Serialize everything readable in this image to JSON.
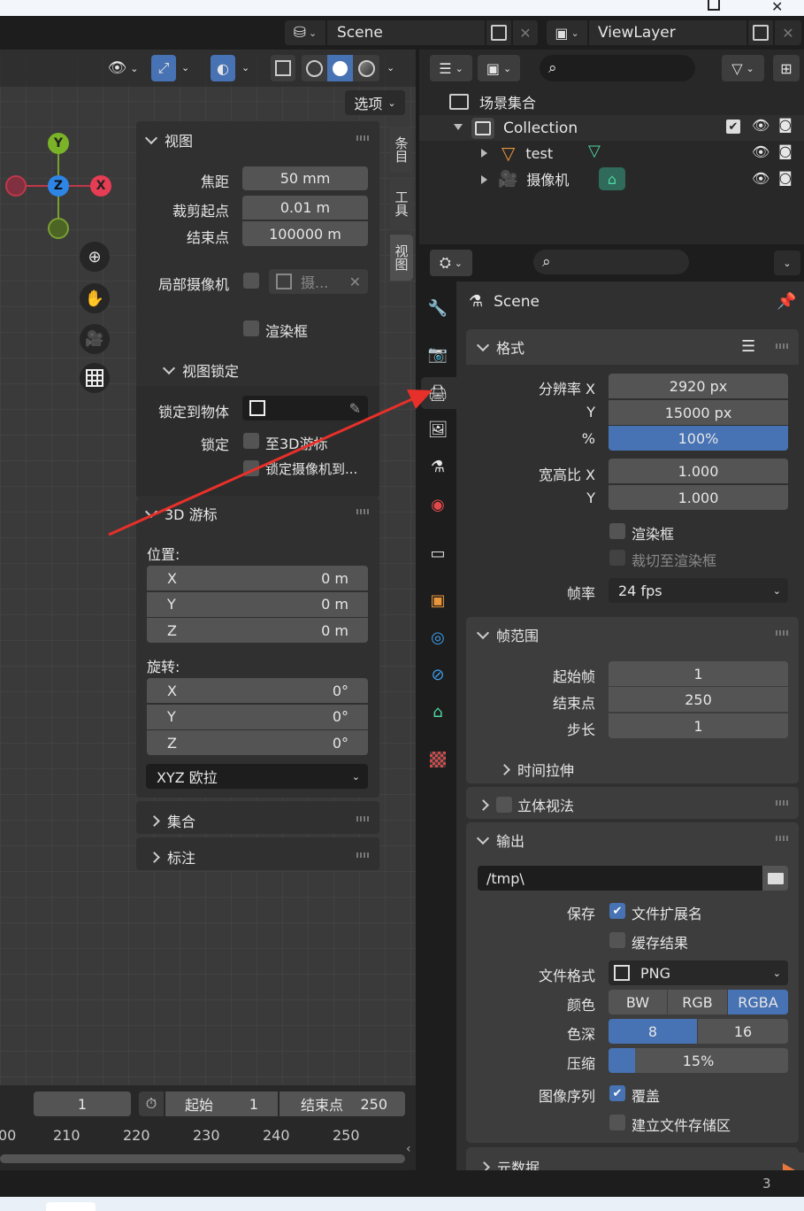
{
  "header": {
    "scene": "Scene",
    "view_layer": "ViewLayer"
  },
  "viewport": {
    "options_label": "选项",
    "gizmo": {
      "y": "Y",
      "z": "Z",
      "x": "X"
    },
    "tabs": [
      "条目",
      "工具",
      "视图"
    ]
  },
  "n_panel": {
    "view_title": "视图",
    "focal_label": "焦距",
    "focal_value": "50 mm",
    "clip_start_label": "裁剪起点",
    "clip_start_value": "0.01 m",
    "clip_end_label": "结束点",
    "clip_end_value": "100000 m",
    "local_camera_label": "局部摄像机",
    "local_camera_value": "摄...",
    "render_border_label": "渲染框",
    "view_lock_title": "视图锁定",
    "lock_object_label": "锁定到物体",
    "lock_label": "锁定",
    "lock_cursor_label": "至3D游标",
    "lock_camera_label": "锁定摄像机到...",
    "cursor_title": "3D 游标",
    "location_label": "位置:",
    "loc": [
      {
        "axis": "X",
        "value": "0 m"
      },
      {
        "axis": "Y",
        "value": "0 m"
      },
      {
        "axis": "Z",
        "value": "0 m"
      }
    ],
    "rotation_label": "旋转:",
    "rot": [
      {
        "axis": "X",
        "value": "0°"
      },
      {
        "axis": "Y",
        "value": "0°"
      },
      {
        "axis": "Z",
        "value": "0°"
      }
    ],
    "rot_mode": "XYZ 欧拉",
    "collection_title": "集合",
    "annotation_title": "标注"
  },
  "timeline": {
    "current_frame": "1",
    "start_label": "起始",
    "start_value": "1",
    "end_label": "结束点",
    "end_value": "250",
    "ruler": [
      "00",
      "210",
      "220",
      "230",
      "240",
      "250"
    ]
  },
  "outliner": {
    "scene_collection": "场景集合",
    "collection": "Collection",
    "items": [
      {
        "name": "test"
      },
      {
        "name": "摄像机"
      }
    ]
  },
  "properties": {
    "scene_name": "Scene",
    "format_title": "格式",
    "res_x_label": "分辨率 X",
    "res_x": "2920 px",
    "res_y_label": "Y",
    "res_y": "15000 px",
    "res_pct_label": "%",
    "res_pct": "100%",
    "aspect_x_label": "宽高比 X",
    "aspect_x": "1.000",
    "aspect_y_label": "Y",
    "aspect_y": "1.000",
    "render_region_label": "渲染框",
    "crop_label": "裁切至渲染框",
    "fps_label": "帧率",
    "fps": "24 fps",
    "frame_range_title": "帧范围",
    "frame_start_label": "起始帧",
    "frame_start": "1",
    "frame_end_label": "结束点",
    "frame_end": "250",
    "frame_step_label": "步长",
    "frame_step": "1",
    "time_stretch_title": "时间拉伸",
    "stereo_title": "立体视法",
    "output_title": "输出",
    "output_path": "/tmp\\",
    "save_label": "保存",
    "file_ext_label": "文件扩展名",
    "cache_label": "缓存结果",
    "file_format_label": "文件格式",
    "file_format": "PNG",
    "color_label": "颜色",
    "color_opts": [
      "BW",
      "RGB",
      "RGBA"
    ],
    "depth_label": "色深",
    "depth_opts": [
      "8",
      "16"
    ],
    "compression_label": "压缩",
    "compression": "15%",
    "compression_level": 0.15,
    "image_seq_label": "图像序列",
    "overwrite_label": "覆盖",
    "placeholders_label": "建立文件存储区",
    "metadata_title": "元数据",
    "status_number": "3"
  },
  "colors": {
    "accent": "#4772b3",
    "arrow": "#e8302a",
    "bg": "#303030"
  }
}
